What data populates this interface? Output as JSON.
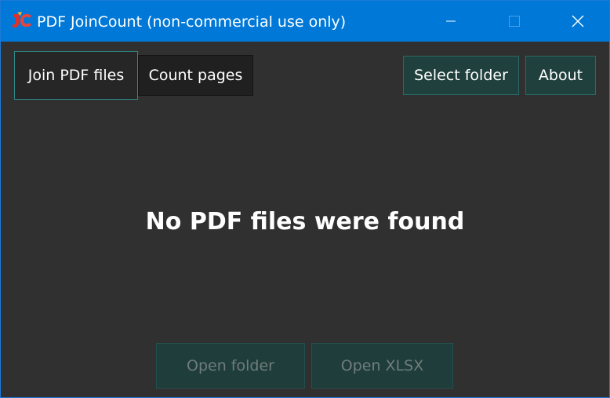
{
  "window": {
    "title": "PDF JoinCount (non-commercial use only)",
    "accent_color": "#0078d7"
  },
  "tabs": [
    {
      "label": "Join PDF files",
      "selected": true
    },
    {
      "label": "Count pages",
      "selected": false
    }
  ],
  "toolbar": {
    "select_folder_label": "Select folder",
    "about_label": "About"
  },
  "main": {
    "message": "No PDF files were found"
  },
  "actions": {
    "open_folder_label": "Open folder",
    "open_xlsx_label": "Open XLSX",
    "enabled": false
  },
  "icons": {
    "app": "app-logo-icon",
    "minimize": "minimize-icon",
    "maximize": "maximize-icon",
    "close": "close-icon"
  }
}
